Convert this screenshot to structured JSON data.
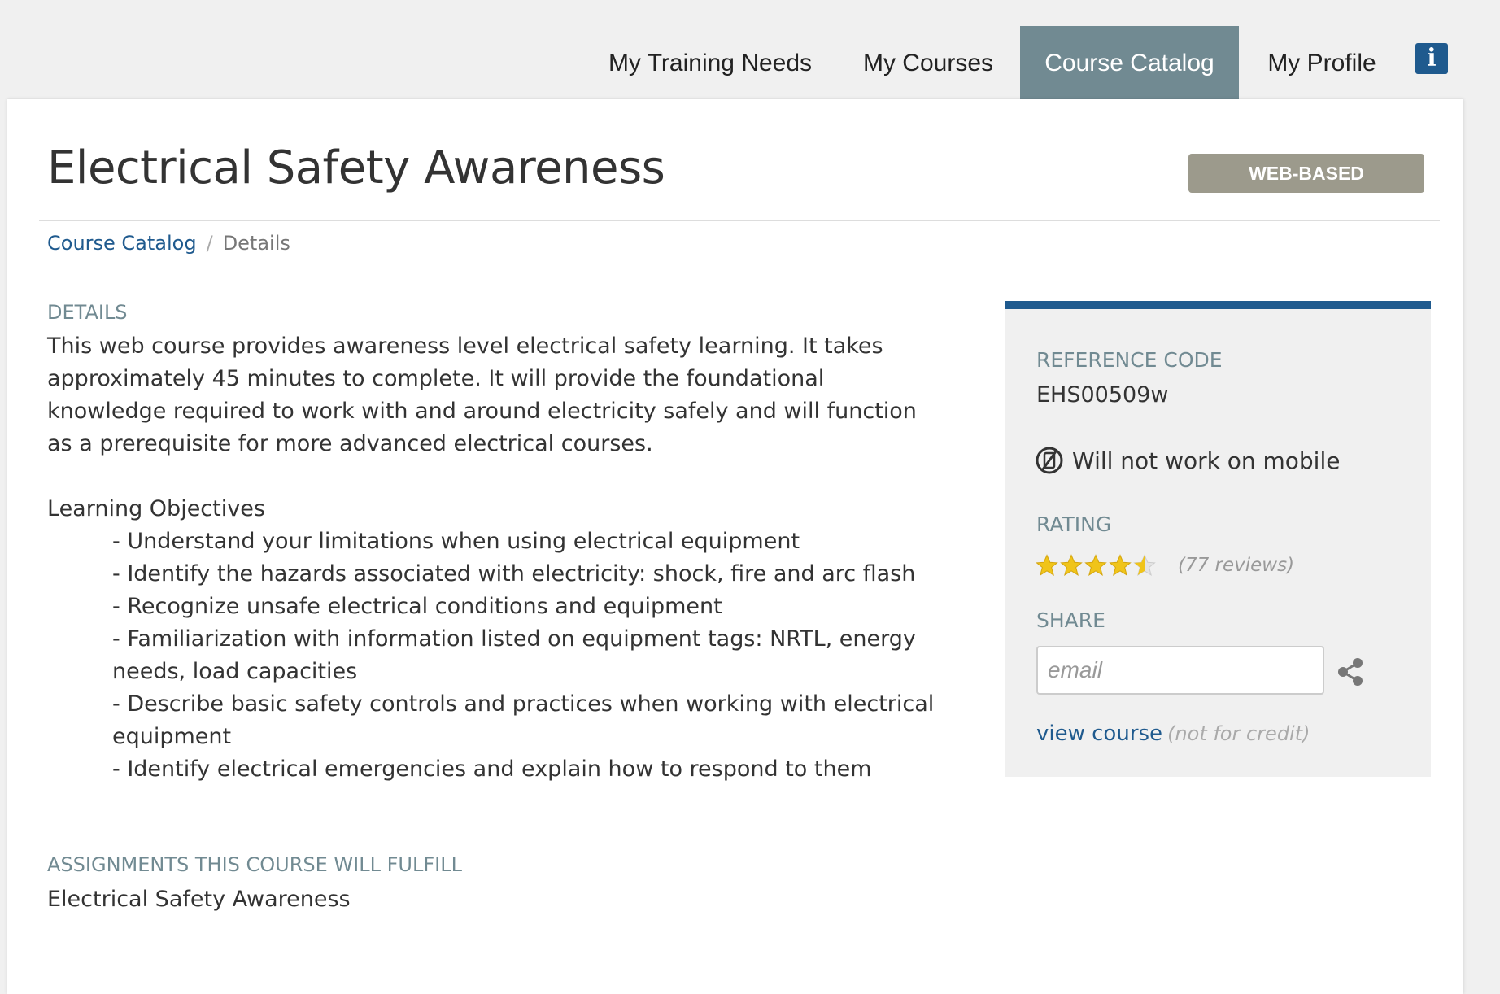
{
  "nav": {
    "items": [
      {
        "label": "My Training Needs",
        "active": false
      },
      {
        "label": "My Courses",
        "active": false
      },
      {
        "label": "Course Catalog",
        "active": true
      },
      {
        "label": "My Profile",
        "active": false
      }
    ],
    "info_icon": "info-icon"
  },
  "course": {
    "title": "Electrical Safety Awareness",
    "badge": "WEB-BASED"
  },
  "breadcrumb": {
    "link": "Course Catalog",
    "current": "Details"
  },
  "details": {
    "label": "DETAILS",
    "text": "This web course provides awareness level electrical safety learning. It takes approximately 45 minutes to complete. It will provide the foundational knowledge required to work with and around electricity safely and will function as a prerequisite for more advanced electrical courses.",
    "objectives_heading": "Learning Objectives",
    "objectives": [
      "- Understand your limitations when using electrical equipment",
      "- Identify the hazards associated with electricity: shock, fire and arc flash",
      "- Recognize unsafe electrical conditions and equipment",
      "- Familiarization with information listed on equipment tags: NRTL, energy needs, load capacities",
      "- Describe basic safety controls and practices when working with electrical equipment",
      "- Identify electrical emergencies and explain how to respond to them"
    ]
  },
  "assignments": {
    "label": "ASSIGNMENTS THIS COURSE WILL FULFILL",
    "value": "Electrical Safety Awareness"
  },
  "sidebar": {
    "ref_label": "REFERENCE CODE",
    "ref_value": "EHS00509w",
    "mobile_text": "Will not work on mobile",
    "rating_label": "RATING",
    "rating": 4.5,
    "rating_max": 5,
    "reviews": "(77 reviews)",
    "share_label": "SHARE",
    "email_placeholder": "email",
    "view_course": "view course",
    "not_for_credit": "(not for credit)"
  },
  "colors": {
    "accent": "#1f5a8e",
    "nav_active": "#718a92",
    "badge": "#9c9a8c",
    "star": "#f0c419"
  }
}
